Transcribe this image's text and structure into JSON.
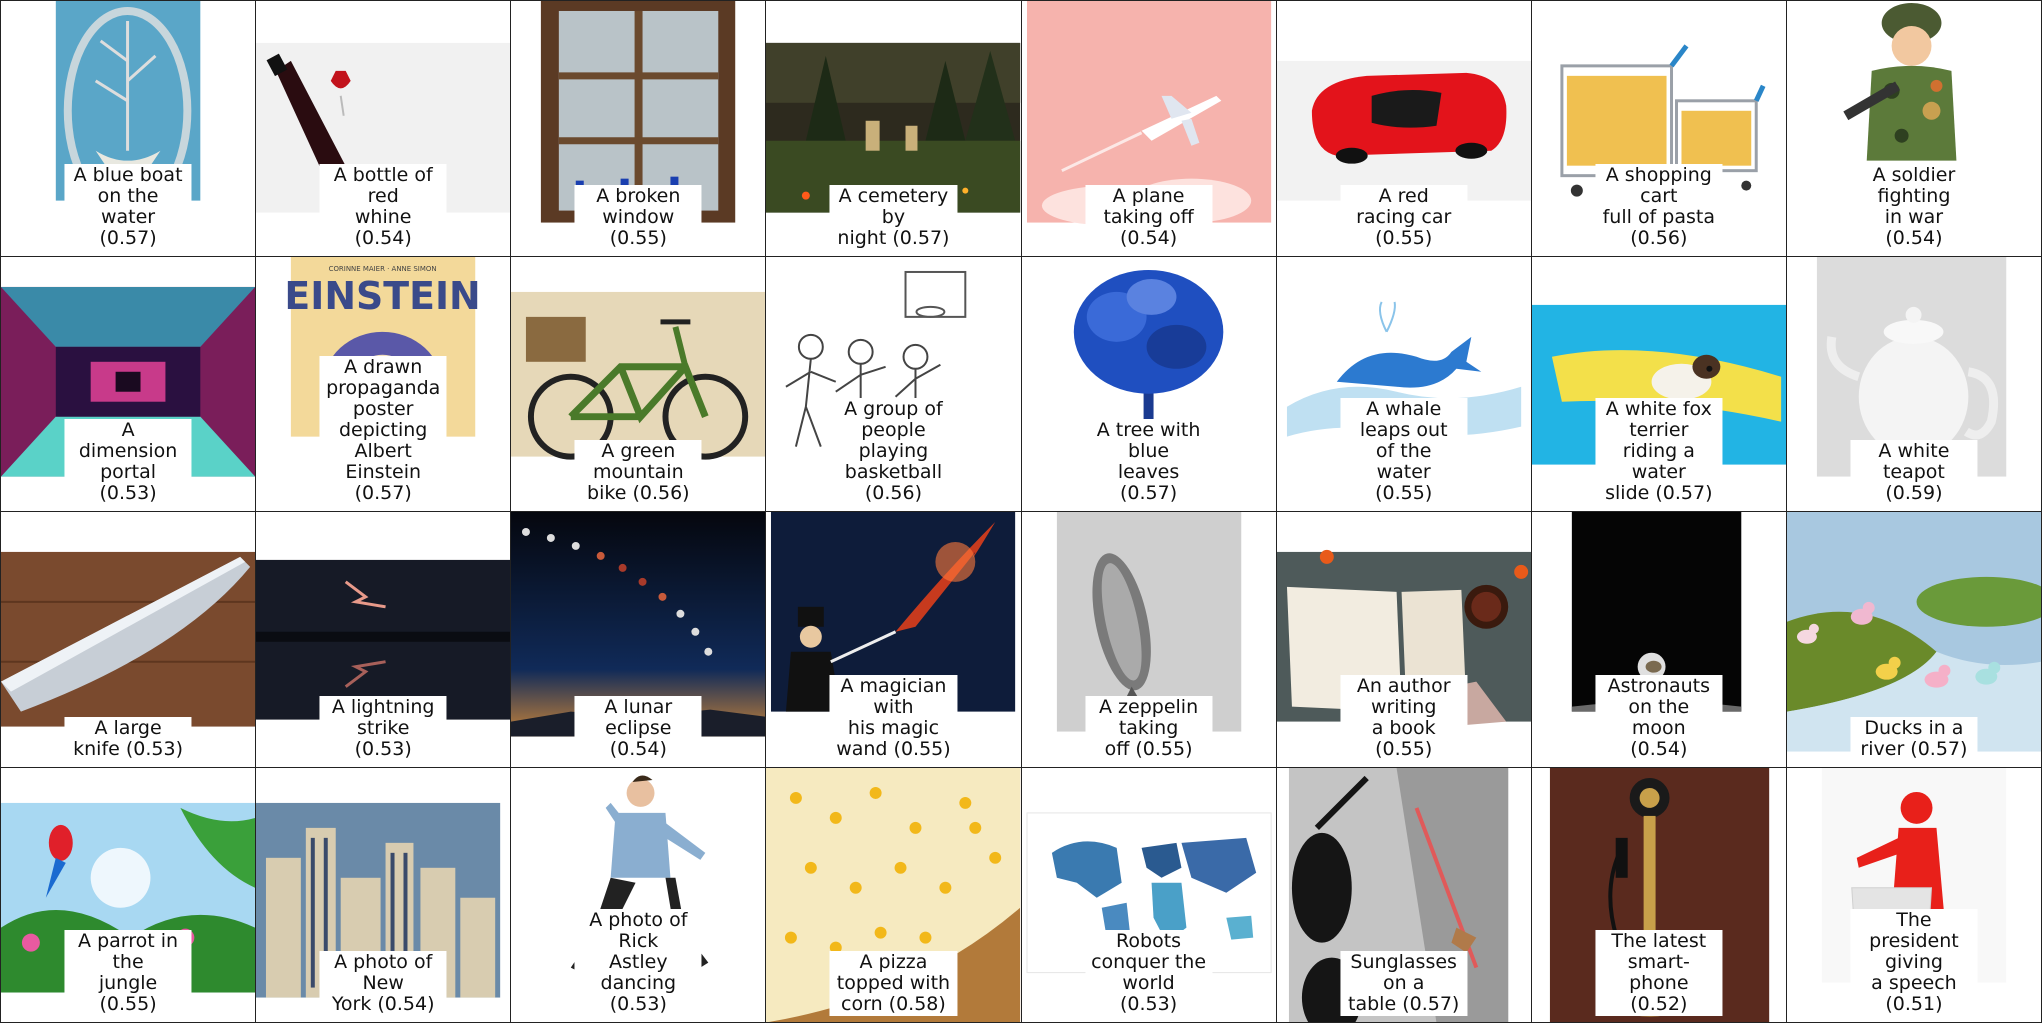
{
  "figure": {
    "cells": [
      {
        "caption": "A blue boat on the\nwater (0.57)",
        "icon": "boat-image"
      },
      {
        "caption": "A bottle of red\nwhine (0.54)",
        "icon": "wine-bottle-image"
      },
      {
        "caption": "A broken window (0.55)",
        "icon": "window-image"
      },
      {
        "caption": "A cemetery by\nnight (0.57)",
        "icon": "cemetery-image"
      },
      {
        "caption": "A plane taking off (0.54)",
        "icon": "plane-image"
      },
      {
        "caption": "A red racing car (0.55)",
        "icon": "race-car-image"
      },
      {
        "caption": "A shopping cart\nfull of pasta (0.56)",
        "icon": "shopping-cart-image"
      },
      {
        "caption": "A soldier fighting\nin war (0.54)",
        "icon": "soldier-image"
      },
      {
        "caption": "A dimension portal (0.53)",
        "icon": "portal-image"
      },
      {
        "caption": "A drawn propaganda\nposter depicting Albert\nEinstein (0.57)",
        "icon": "einstein-poster-image",
        "poster_text": "EINSTEIN",
        "poster_sub": "CORINNE MAIER · ANNE SIMON"
      },
      {
        "caption": "A green mountain\nbike (0.56)",
        "icon": "bicycle-image"
      },
      {
        "caption": "A group of people\nplaying basketball (0.56)",
        "icon": "basketball-sketch-image"
      },
      {
        "caption": "A tree with blue\nleaves (0.57)",
        "icon": "blue-tree-image"
      },
      {
        "caption": "A whale leaps out\nof the water (0.55)",
        "icon": "whale-image"
      },
      {
        "caption": "A white fox terrier\nriding a water\nslide (0.57)",
        "icon": "dog-water-slide-image"
      },
      {
        "caption": "A white teapot (0.59)",
        "icon": "teapot-image"
      },
      {
        "caption": "A large knife (0.53)",
        "icon": "knife-image"
      },
      {
        "caption": "A lightning strike (0.53)",
        "icon": "lightning-image"
      },
      {
        "caption": "A lunar eclipse (0.54)",
        "icon": "lunar-eclipse-image"
      },
      {
        "caption": "A magician with\nhis magic wand (0.55)",
        "icon": "magician-image"
      },
      {
        "caption": "A zeppelin taking\noff (0.55)",
        "icon": "zeppelin-image"
      },
      {
        "caption": "An author writing\na book (0.55)",
        "icon": "book-image"
      },
      {
        "caption": "Astronauts on the\nmoon (0.54)",
        "icon": "astronaut-image"
      },
      {
        "caption": "Ducks in a river (0.57)",
        "icon": "ducks-image"
      },
      {
        "caption": "A parrot in the\njungle (0.55)",
        "icon": "parrot-image"
      },
      {
        "caption": "A photo of New\nYork (0.54)",
        "icon": "new-york-image"
      },
      {
        "caption": "A photo of Rick\nAstley dancing (0.53)",
        "icon": "dancer-image"
      },
      {
        "caption": "A pizza topped with\ncorn (0.58)",
        "icon": "pizza-image"
      },
      {
        "caption": "Robots conquer the\nworld (0.53)",
        "icon": "robot-map-image"
      },
      {
        "caption": "Sunglasses on a\ntable (0.57)",
        "icon": "sunglasses-image"
      },
      {
        "caption": "The latest smart-\nphone (0.52)",
        "icon": "telephone-image"
      },
      {
        "caption": "The president giving\na speech (0.51)",
        "icon": "speech-image"
      }
    ]
  }
}
